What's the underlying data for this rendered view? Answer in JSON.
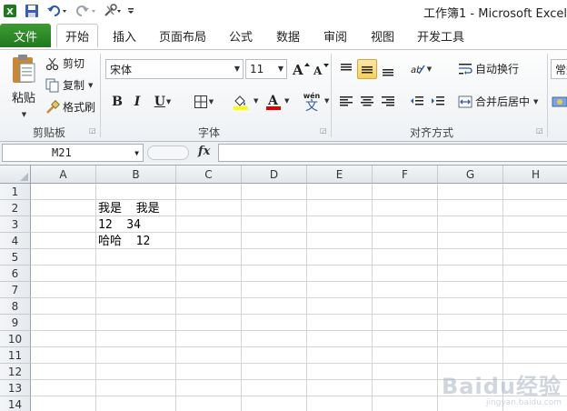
{
  "window": {
    "title": "工作簿1 - Microsoft Excel"
  },
  "quick_access": {
    "icons": [
      "excel-icon",
      "save-icon",
      "undo-icon",
      "redo-icon",
      "tools-icon",
      "customize-icon"
    ]
  },
  "tabs": [
    {
      "label": "文件"
    },
    {
      "label": "开始"
    },
    {
      "label": "插入"
    },
    {
      "label": "页面布局"
    },
    {
      "label": "公式"
    },
    {
      "label": "数据"
    },
    {
      "label": "审阅"
    },
    {
      "label": "视图"
    },
    {
      "label": "开发工具"
    }
  ],
  "ribbon": {
    "clipboard": {
      "paste": "粘贴",
      "cut": "剪切",
      "copy": "复制",
      "format_painter": "格式刷",
      "group_label": "剪贴板"
    },
    "font": {
      "font_name": "宋体",
      "font_size": "11",
      "bold": "B",
      "italic": "I",
      "underline": "U",
      "font_color_letter": "A",
      "phonetic": "wén",
      "phonetic_char": "文",
      "group_label": "字体",
      "fill_color": "#ffff00",
      "text_color": "#e00000"
    },
    "alignment": {
      "wrap_text": "自动换行",
      "merge_center": "合并后居中",
      "group_label": "对齐方式"
    },
    "number": {
      "format": "常规"
    }
  },
  "formula_bar": {
    "name_box": "M21",
    "fx": "fx",
    "value": ""
  },
  "sheet": {
    "columns": [
      "A",
      "B",
      "C",
      "D",
      "E",
      "F",
      "G",
      "H"
    ],
    "rows": [
      "1",
      "2",
      "3",
      "4",
      "5",
      "6",
      "7",
      "8",
      "9",
      "10",
      "11",
      "12",
      "13",
      "14"
    ],
    "cells": {
      "B2": "我是  我是",
      "B3": "12  34",
      "B4": "哈哈  12"
    }
  },
  "watermark": {
    "brand": "Baidu经验",
    "url": "jingyan.baidu.com"
  }
}
